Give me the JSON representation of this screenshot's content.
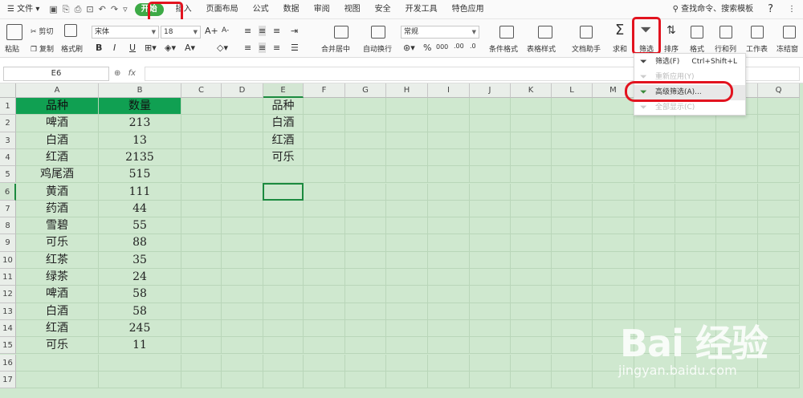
{
  "menubar": {
    "file": "文件",
    "tabs": [
      "开始",
      "插入",
      "页面布局",
      "公式",
      "数据",
      "审阅",
      "视图",
      "安全",
      "开发工具",
      "特色应用"
    ],
    "search": "查找命令、搜索模板",
    "help": "?"
  },
  "ribbon": {
    "paste": "粘贴",
    "cut": "剪切",
    "copy": "复制",
    "format_painter": "格式刷",
    "font_name": "宋体",
    "font_size": "18",
    "bold": "B",
    "italic": "I",
    "underline": "U",
    "merge_center": "合并居中",
    "wrap_text": "自动换行",
    "number_format": "常规",
    "percent": "%",
    "thousands": "000",
    "conditional_format": "条件格式",
    "table_style": "表格样式",
    "doc_helper": "文档助手",
    "sum": "求和",
    "filter": "筛选",
    "sort": "排序",
    "format": "格式",
    "rows_cols": "行和列",
    "worksheet": "工作表",
    "freeze": "冻结窗",
    "grow_font": "A+",
    "shrink_font": "A-"
  },
  "formula_bar": {
    "name_box": "E6",
    "fx": "fx",
    "content": ""
  },
  "sheet": {
    "columns": [
      "A",
      "B",
      "C",
      "D",
      "E",
      "F",
      "G",
      "H",
      "I",
      "J",
      "K",
      "L",
      "M",
      "N",
      "O",
      "P",
      "Q"
    ],
    "rows": [
      "1",
      "2",
      "3",
      "4",
      "5",
      "6",
      "7",
      "8",
      "9",
      "10",
      "11",
      "12",
      "13",
      "14",
      "15",
      "16",
      "17"
    ],
    "col_a": [
      "品种",
      "啤酒",
      "白酒",
      "红酒",
      "鸡尾酒",
      "黄酒",
      "药酒",
      "雪碧",
      "可乐",
      "红茶",
      "绿茶",
      "啤酒",
      "白酒",
      "红酒",
      "可乐"
    ],
    "col_b": [
      "数量",
      "213",
      "13",
      "2135",
      "515",
      "111",
      "44",
      "55",
      "88",
      "35",
      "24",
      "58",
      "58",
      "245",
      "11"
    ],
    "col_e": [
      "品种",
      "白酒",
      "红酒",
      "可乐"
    ],
    "header_color": "#10a052",
    "selected_cell": "E6"
  },
  "filter_menu": {
    "items": [
      {
        "label": "筛选(F)",
        "shortcut": "Ctrl+Shift+L"
      },
      {
        "label": "重新应用(Y)",
        "shortcut": ""
      },
      {
        "label": "高级筛选(A)...",
        "shortcut": ""
      },
      {
        "label": "全部显示(C)",
        "shortcut": ""
      }
    ]
  },
  "watermark": {
    "logo": "Bai 经验",
    "url": "jingyan.baidu.com"
  }
}
